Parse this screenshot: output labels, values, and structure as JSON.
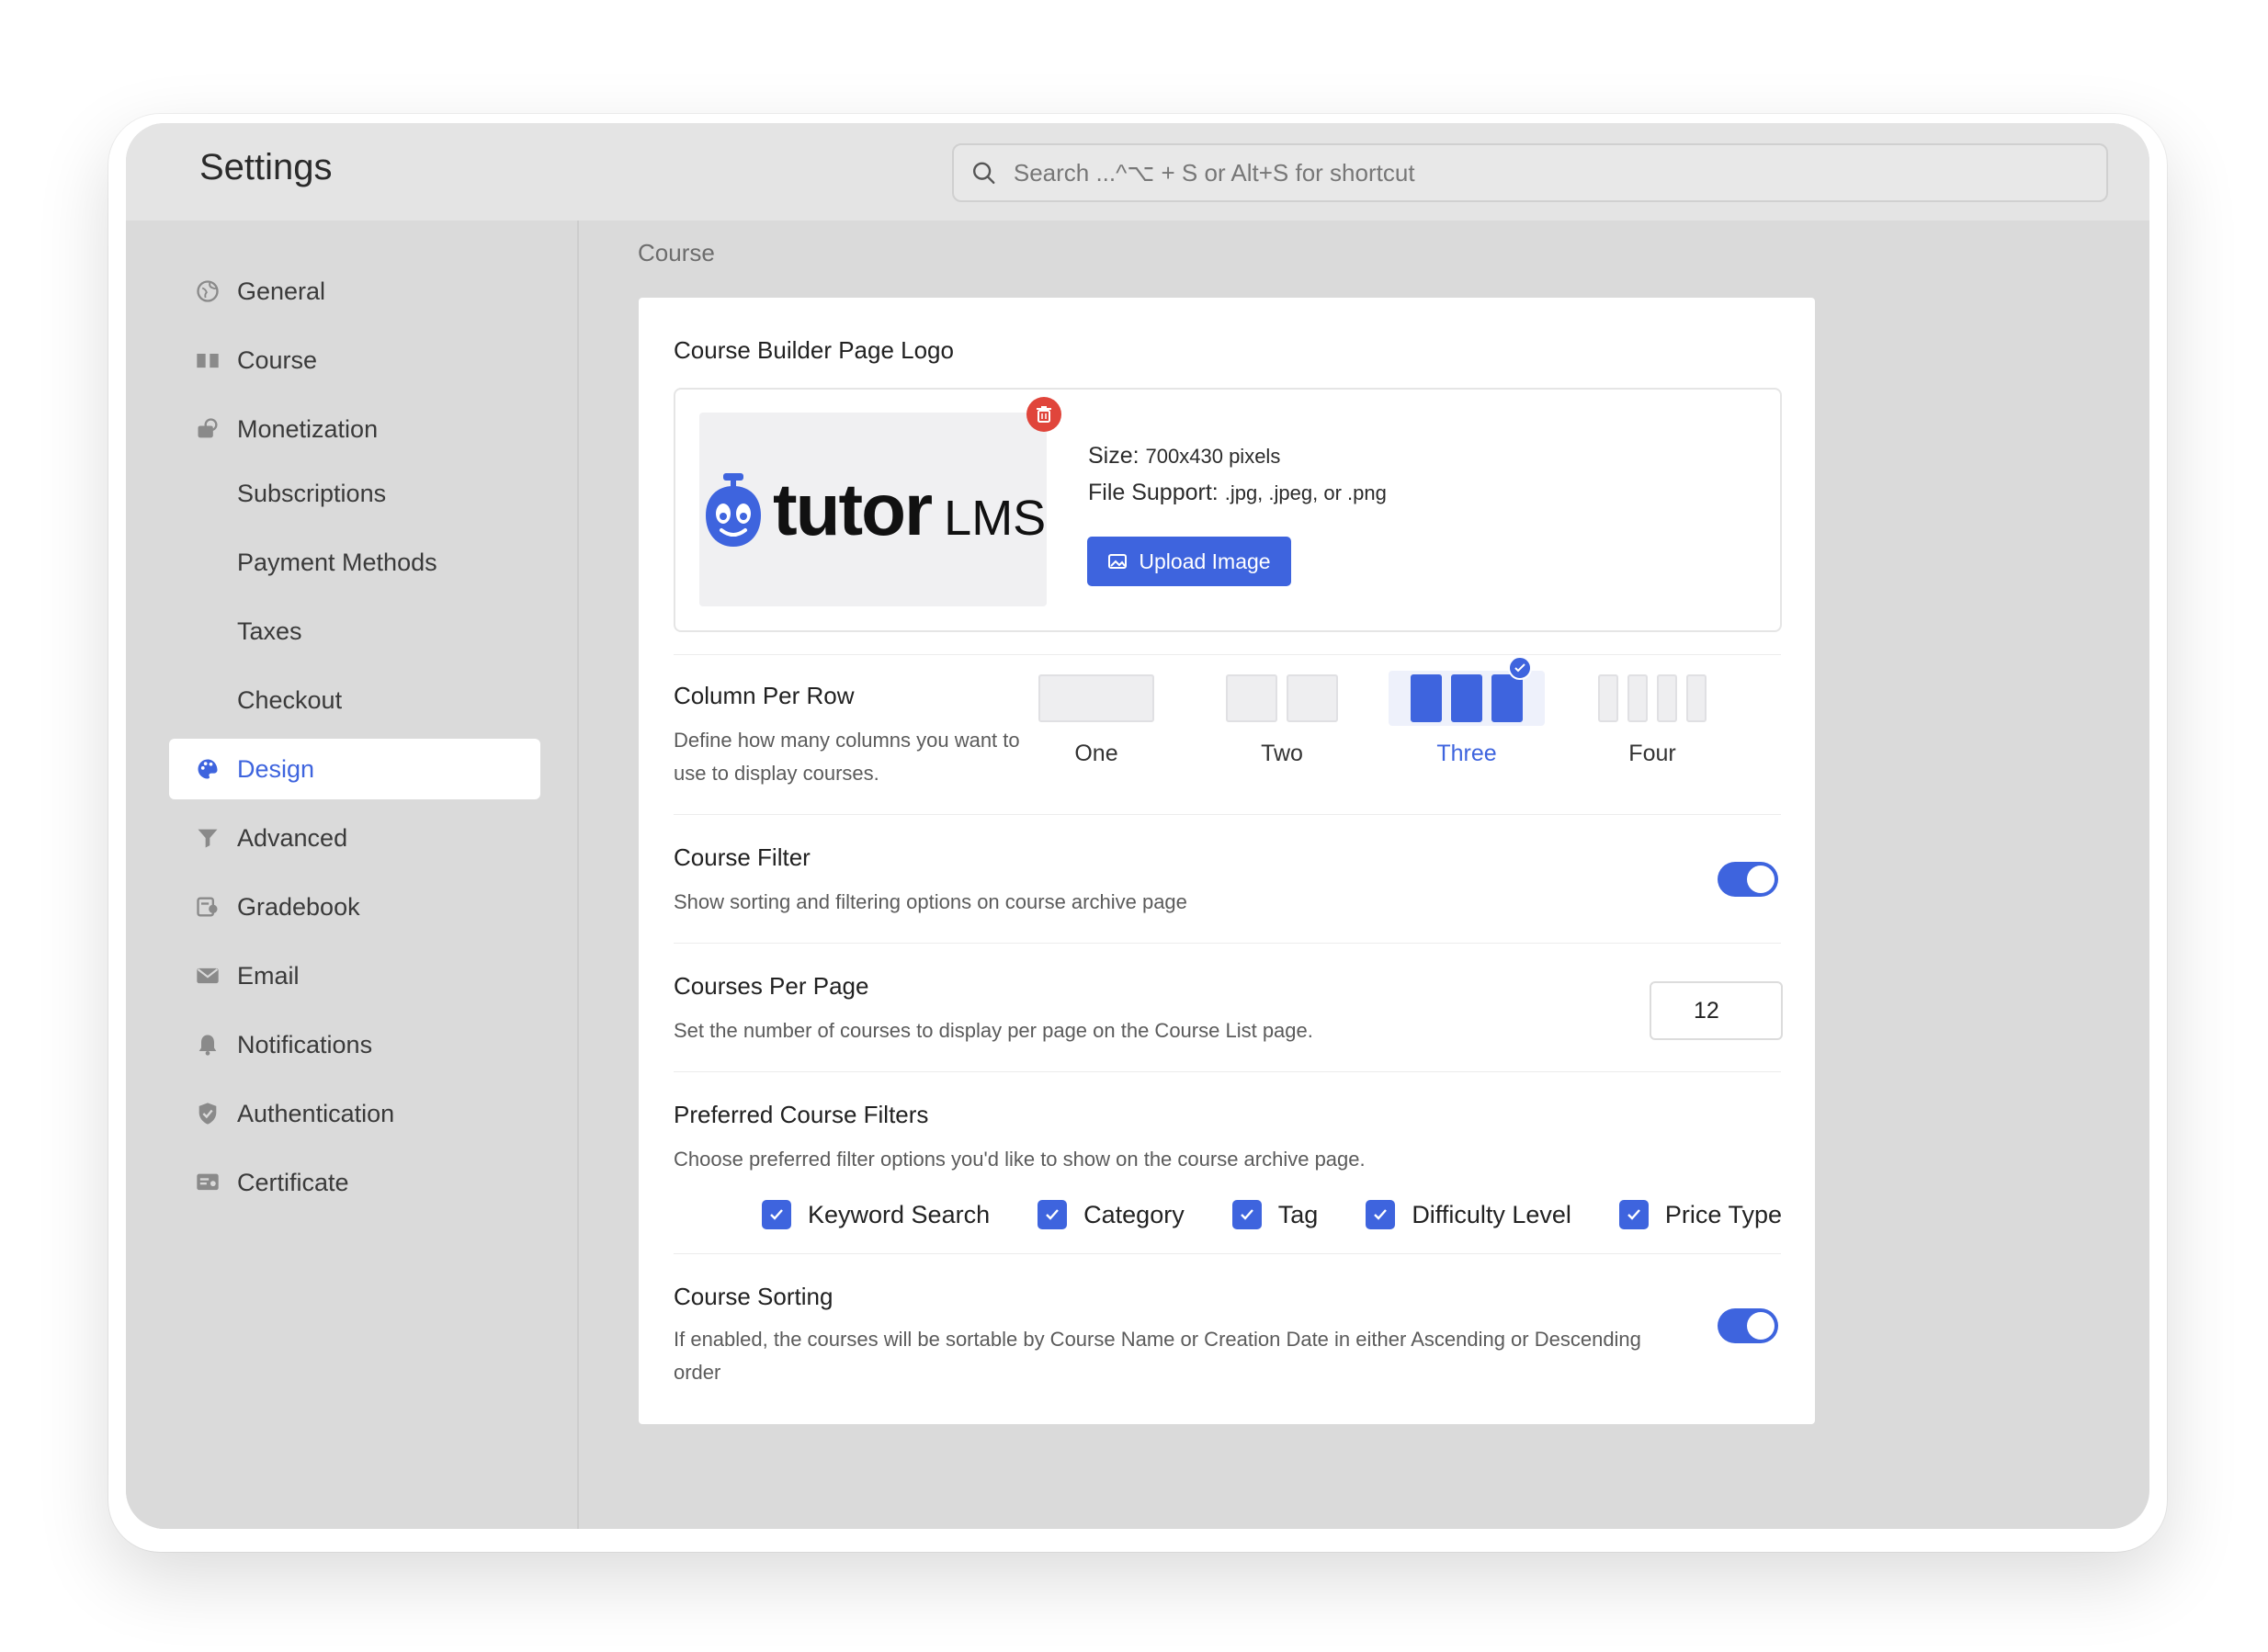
{
  "app": {
    "title": "Settings"
  },
  "search": {
    "placeholder": "Search ...^⌥ + S or Alt+S for shortcut"
  },
  "sidebar": {
    "items": [
      {
        "label": "General",
        "icon": "globe-icon"
      },
      {
        "label": "Course",
        "icon": "book-icon"
      },
      {
        "label": "Monetization",
        "icon": "coins-icon"
      },
      {
        "label": "Subscriptions"
      },
      {
        "label": "Payment Methods"
      },
      {
        "label": "Taxes"
      },
      {
        "label": "Checkout"
      },
      {
        "label": "Design",
        "icon": "palette-icon",
        "active": true
      },
      {
        "label": "Advanced",
        "icon": "filter-icon"
      },
      {
        "label": "Gradebook",
        "icon": "gradebook-icon"
      },
      {
        "label": "Email",
        "icon": "envelope-icon"
      },
      {
        "label": "Notifications",
        "icon": "bell-icon"
      },
      {
        "label": "Authentication",
        "icon": "shield-icon"
      },
      {
        "label": "Certificate",
        "icon": "certificate-icon"
      }
    ]
  },
  "main": {
    "breadcrumb": "Course",
    "logo": {
      "title": "Course Builder Page Logo",
      "brand_word": "tutor",
      "brand_suffix": "LMS",
      "size_label": "Size:",
      "size_value": "700x430 pixels",
      "support_label": "File Support:",
      "support_value": ".jpg, .jpeg, or .png",
      "upload_label": "Upload Image"
    },
    "columns": {
      "title": "Column Per Row",
      "desc_line1": "Define how many columns you want to",
      "desc_line2": "use to display courses.",
      "options": [
        "One",
        "Two",
        "Three",
        "Four"
      ],
      "selected": "Three"
    },
    "course_filter": {
      "title": "Course Filter",
      "desc": "Show sorting and filtering options on course archive page",
      "enabled": true
    },
    "per_page": {
      "title": "Courses Per Page",
      "desc": "Set the number of courses to display per page on the Course List page.",
      "value": "12"
    },
    "preferred_filters": {
      "title": "Preferred Course Filters",
      "desc": "Choose preferred filter options you'd like to show on the course archive page.",
      "options": [
        "Keyword Search",
        "Category",
        "Tag",
        "Difficulty Level",
        "Price Type"
      ]
    },
    "sorting": {
      "title": "Course Sorting",
      "desc_line1": "If enabled, the courses will be sortable by Course Name or Creation Date in either Ascending or Descending",
      "desc_line2": "order",
      "enabled": true
    }
  },
  "colors": {
    "accent": "#3e64de",
    "danger": "#e0453b"
  }
}
